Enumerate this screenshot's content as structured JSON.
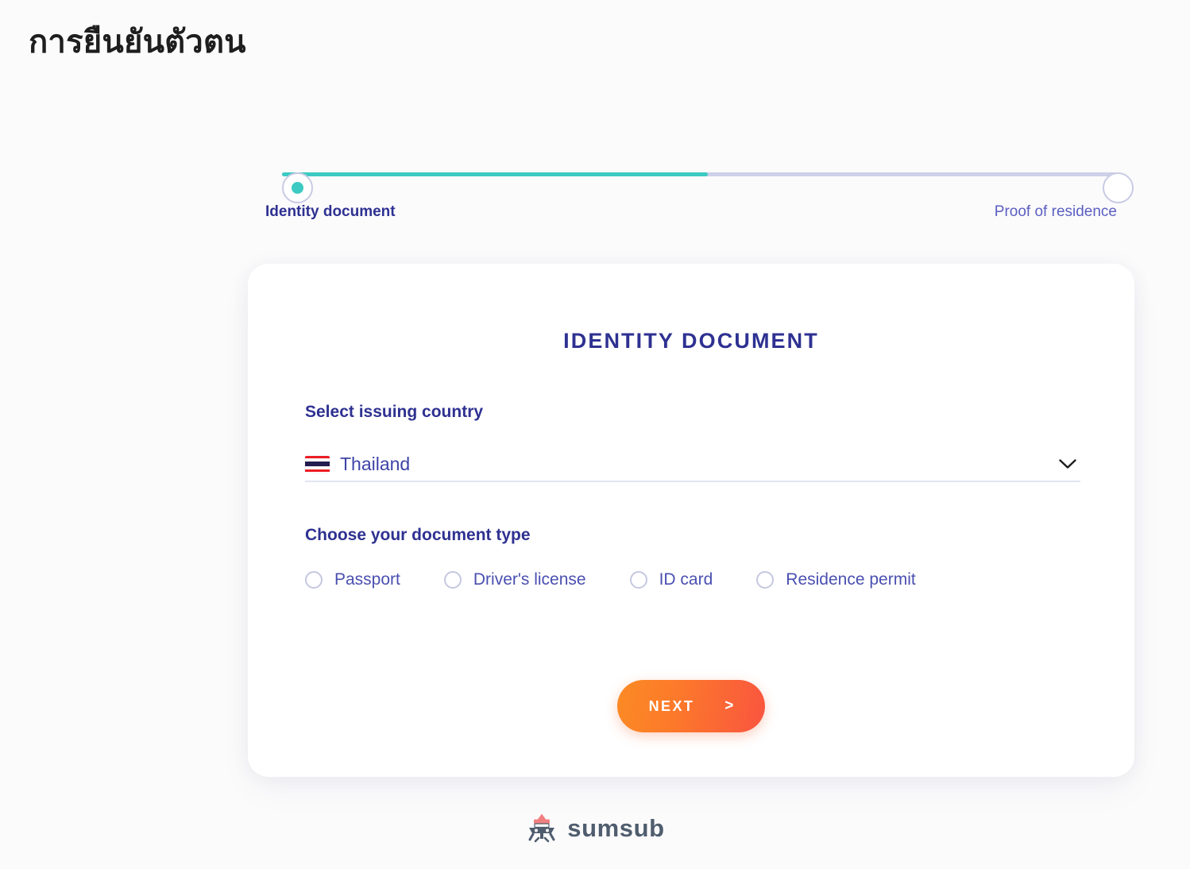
{
  "page": {
    "title": "การยืนยันตัวตน",
    "background_color": "#fbfbfc"
  },
  "stepper": {
    "progress_percent": 50,
    "active_color": "#3ccac2",
    "inactive_color": "#cdd0e8",
    "steps": [
      {
        "label": "Identity document",
        "state": "active"
      },
      {
        "label": "Proof of residence",
        "state": "inactive"
      }
    ]
  },
  "card": {
    "title": "IDENTITY DOCUMENT",
    "title_color": "#2e3191",
    "country_field": {
      "label": "Select issuing country",
      "selected_value": "Thailand",
      "flag": "thailand-flag-icon",
      "chevron": "chevron-down-icon"
    },
    "doctype_field": {
      "label": "Choose your document type",
      "options": [
        {
          "label": "Passport",
          "selected": false
        },
        {
          "label": "Driver's license",
          "selected": false
        },
        {
          "label": "ID card",
          "selected": false
        },
        {
          "label": "Residence permit",
          "selected": false
        }
      ]
    },
    "next_button": {
      "label": "NEXT",
      "arrow": ">",
      "gradient_from": "#fb8b24",
      "gradient_to": "#f9553f"
    }
  },
  "footer": {
    "logo_text": "sumsub",
    "logo_mark": "sumsub-logo-icon",
    "logo_accent_color": "#f08080",
    "logo_body_color": "#4f5d6e"
  }
}
